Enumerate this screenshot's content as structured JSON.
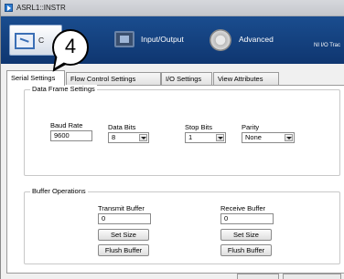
{
  "window": {
    "title": "ASRL1::INSTR"
  },
  "toolbar": {
    "serial_label": "C",
    "io_label": "Input/Output",
    "advanced_label": "Advanced",
    "trace_label": "NI I/O Trac"
  },
  "callout": {
    "number": "4"
  },
  "tabs": [
    {
      "label": "Serial Settings",
      "active": true
    },
    {
      "label": "Flow Control Settings",
      "active": false
    },
    {
      "label": "I/O Settings",
      "active": false
    },
    {
      "label": "View Attributes",
      "active": false
    }
  ],
  "data_frame": {
    "title": "Data Frame Settings",
    "baud_rate": {
      "label": "Baud Rate",
      "value": "9600"
    },
    "data_bits": {
      "label": "Data Bits",
      "value": "8"
    },
    "stop_bits": {
      "label": "Stop Bits",
      "value": "1"
    },
    "parity": {
      "label": "Parity",
      "value": "None"
    }
  },
  "buffer_ops": {
    "title": "Buffer Operations",
    "transmit": {
      "label": "Transmit Buffer",
      "value": "0",
      "set_size": "Set Size",
      "flush": "Flush Buffer"
    },
    "receive": {
      "label": "Receive Buffer",
      "value": "0",
      "set_size": "Set Size",
      "flush": "Flush Buffer"
    }
  }
}
